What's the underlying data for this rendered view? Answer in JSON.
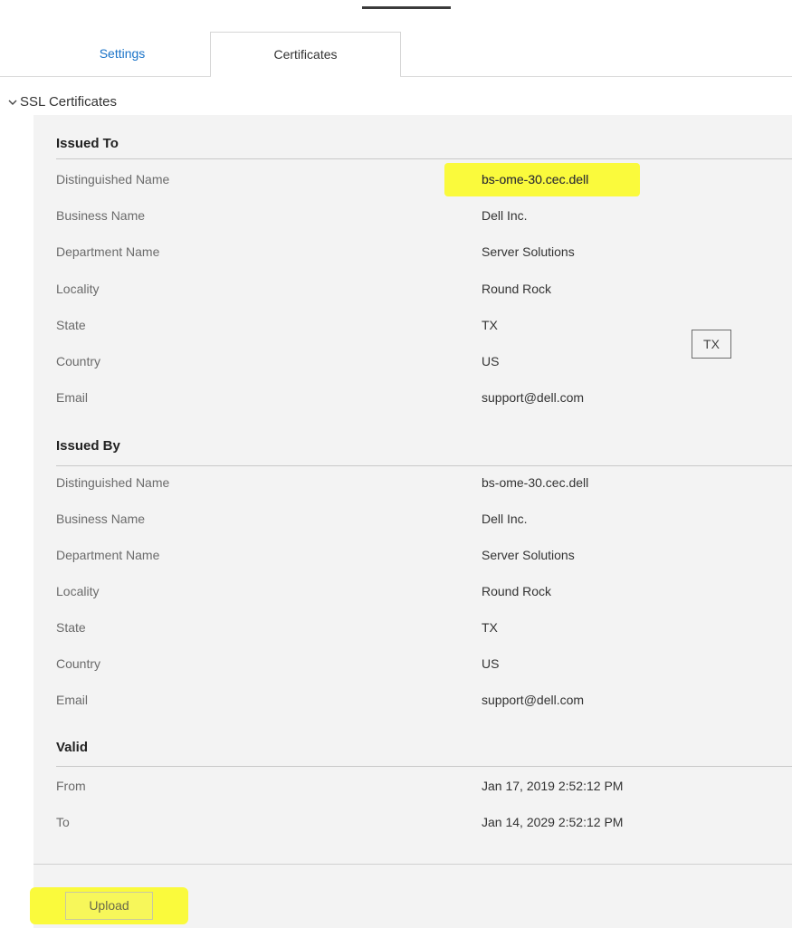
{
  "tabs": [
    {
      "label": "Settings",
      "active": false
    },
    {
      "label": "Certificates",
      "active": true
    }
  ],
  "section": {
    "title": "SSL Certificates",
    "expanded": true
  },
  "issued_to": {
    "title": "Issued To",
    "rows": [
      {
        "label": "Distinguished Name",
        "value": "bs-ome-30.cec.dell"
      },
      {
        "label": "Business Name",
        "value": "Dell Inc."
      },
      {
        "label": "Department Name",
        "value": "Server Solutions"
      },
      {
        "label": "Locality",
        "value": "Round Rock"
      },
      {
        "label": "State",
        "value": "TX"
      },
      {
        "label": "Country",
        "value": "US"
      },
      {
        "label": "Email",
        "value": "support@dell.com"
      }
    ]
  },
  "tooltip_state": "TX",
  "issued_by": {
    "title": "Issued By",
    "rows": [
      {
        "label": "Distinguished Name",
        "value": "bs-ome-30.cec.dell"
      },
      {
        "label": "Business Name",
        "value": "Dell Inc."
      },
      {
        "label": "Department Name",
        "value": "Server Solutions"
      },
      {
        "label": "Locality",
        "value": "Round Rock"
      },
      {
        "label": "State",
        "value": "TX"
      },
      {
        "label": "Country",
        "value": "US"
      },
      {
        "label": "Email",
        "value": "support@dell.com"
      }
    ]
  },
  "valid": {
    "title": "Valid",
    "rows": [
      {
        "label": "From",
        "value": "Jan 17, 2019 2:52:12 PM"
      },
      {
        "label": "To",
        "value": "Jan 14, 2029 2:52:12 PM"
      }
    ]
  },
  "actions": {
    "upload_label": "Upload"
  },
  "colors": {
    "accent": "#1a73c8",
    "panel_bg": "#f3f3f3",
    "highlight": "#fafa3c"
  }
}
